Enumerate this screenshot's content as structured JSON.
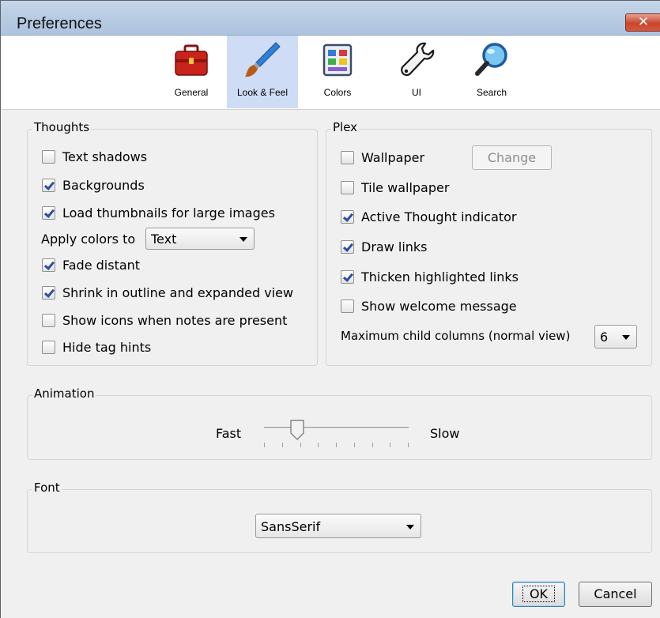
{
  "window": {
    "title": "Preferences",
    "close_label": "✕"
  },
  "toolbar": {
    "tabs": [
      {
        "label": "General",
        "icon": "toolbox-icon"
      },
      {
        "label": "Look & Feel",
        "icon": "paintbrush-icon",
        "selected": true
      },
      {
        "label": "Colors",
        "icon": "palette-icon"
      },
      {
        "label": "UI",
        "icon": "wrench-icon"
      },
      {
        "label": "Search",
        "icon": "magnifier-icon"
      }
    ]
  },
  "thoughts": {
    "title": "Thoughts",
    "text_shadows": {
      "label": "Text shadows",
      "checked": false
    },
    "backgrounds": {
      "label": "Backgrounds",
      "checked": true
    },
    "load_thumbnails": {
      "label": "Load thumbnails for large images",
      "checked": true
    },
    "apply_colors_label": "Apply colors to",
    "apply_colors_value": "Text",
    "fade_distant": {
      "label": "Fade distant",
      "checked": true
    },
    "shrink_outline": {
      "label": "Shrink in outline and expanded view",
      "checked": true
    },
    "show_icons": {
      "label": "Show icons when notes are present",
      "checked": false
    },
    "hide_tag_hints": {
      "label": "Hide tag hints",
      "checked": false
    }
  },
  "plex": {
    "title": "Plex",
    "wallpaper": {
      "label": "Wallpaper",
      "checked": false
    },
    "change_button": "Change",
    "tile_wallpaper": {
      "label": "Tile wallpaper",
      "checked": false
    },
    "active_indicator": {
      "label": "Active Thought indicator",
      "checked": true
    },
    "draw_links": {
      "label": "Draw links",
      "checked": true
    },
    "thicken_links": {
      "label": "Thicken highlighted links",
      "checked": true
    },
    "welcome_message": {
      "label": "Show welcome message",
      "checked": false
    },
    "max_columns_label": "Maximum child columns (normal view)",
    "max_columns_value": "6"
  },
  "animation": {
    "title": "Animation",
    "fast_label": "Fast",
    "slow_label": "Slow",
    "speed_fraction": 0.23
  },
  "font": {
    "title": "Font",
    "value": "SansSerif"
  },
  "buttons": {
    "ok": "OK",
    "cancel": "Cancel"
  }
}
